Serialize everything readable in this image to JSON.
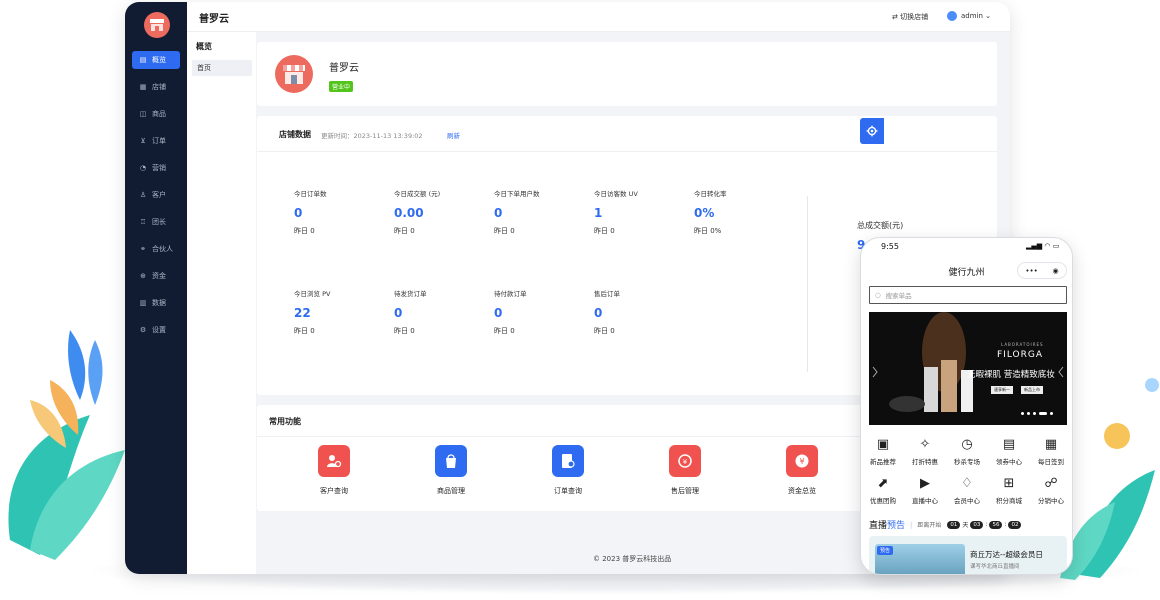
{
  "app": {
    "brand": "普罗云",
    "switch_store": "切换店铺",
    "user": "admin"
  },
  "sidebar": {
    "items": [
      {
        "label": "概览",
        "icon": "overview-icon"
      },
      {
        "label": "店铺",
        "icon": "store-icon"
      },
      {
        "label": "商品",
        "icon": "goods-icon"
      },
      {
        "label": "订单",
        "icon": "cart-icon"
      },
      {
        "label": "营销",
        "icon": "marketing-icon"
      },
      {
        "label": "客户",
        "icon": "user-icon"
      },
      {
        "label": "团长",
        "icon": "team-icon"
      },
      {
        "label": "合伙人",
        "icon": "partner-icon"
      },
      {
        "label": "资金",
        "icon": "funds-icon"
      },
      {
        "label": "数据",
        "icon": "data-icon"
      },
      {
        "label": "设置",
        "icon": "settings-icon"
      }
    ]
  },
  "subnav": {
    "title": "概览",
    "item": "首页"
  },
  "shop": {
    "name": "普罗云",
    "status": "营业中"
  },
  "store_data": {
    "title": "店铺数据",
    "updated": "更新时间：2023-11-13 13:39:02",
    "refresh": "刷新",
    "stats": [
      {
        "label": "今日订单数",
        "value": "0",
        "prev": "昨日 0"
      },
      {
        "label": "今日成交额 (元)",
        "value": "0.00",
        "prev": "昨日 0"
      },
      {
        "label": "今日下单用户数",
        "value": "0",
        "prev": "昨日 0"
      },
      {
        "label": "今日访客数 UV",
        "value": "1",
        "prev": "昨日 0"
      },
      {
        "label": "今日转化率",
        "value": "0%",
        "prev": "昨日 0%"
      },
      {
        "label": "今日浏览 PV",
        "value": "22",
        "prev": "昨日 0"
      },
      {
        "label": "待发货订单",
        "value": "0",
        "prev": "昨日 0"
      },
      {
        "label": "待付款订单",
        "value": "0",
        "prev": "昨日 0"
      },
      {
        "label": "售后订单",
        "value": "0",
        "prev": "昨日 0"
      }
    ],
    "total_label": "总成交额(元)",
    "total_value": "9"
  },
  "functions": {
    "title": "常用功能",
    "items": [
      {
        "label": "客户查询",
        "color": "#f0534f"
      },
      {
        "label": "商品管理",
        "color": "#2f6bf0"
      },
      {
        "label": "订单查询",
        "color": "#2f6bf0"
      },
      {
        "label": "售后管理",
        "color": "#f0534f"
      },
      {
        "label": "资金总览",
        "color": "#f0534f"
      }
    ]
  },
  "footer": "© 2023 普罗云科技出品",
  "phone": {
    "time": "9:55",
    "title": "健行九州",
    "search_placeholder": "搜索单品",
    "banner": {
      "brand_small": "LABORATOIRES",
      "brand": "FILORGA",
      "slogan": "无暇裸肌 营造精致底妆",
      "btn1": "速享新一",
      "btn2": "新品上市"
    },
    "icons": [
      {
        "label": "新品推荐"
      },
      {
        "label": "打折特惠"
      },
      {
        "label": "秒杀专场"
      },
      {
        "label": "领券中心"
      },
      {
        "label": "每日签到"
      },
      {
        "label": "优惠团购"
      },
      {
        "label": "直播中心"
      },
      {
        "label": "会员中心"
      },
      {
        "label": "积分商城"
      },
      {
        "label": "分销中心"
      }
    ],
    "live": {
      "title_a": "直播",
      "title_b": "预告",
      "countdown_label": "距离开始",
      "d": "01",
      "d_unit": "天",
      "h": "03",
      "m": "56",
      "s": "02"
    },
    "live_card": {
      "tag": "预告",
      "title": "商丘万达--超级会员日",
      "sub": "课写华北商丘直播间"
    }
  }
}
